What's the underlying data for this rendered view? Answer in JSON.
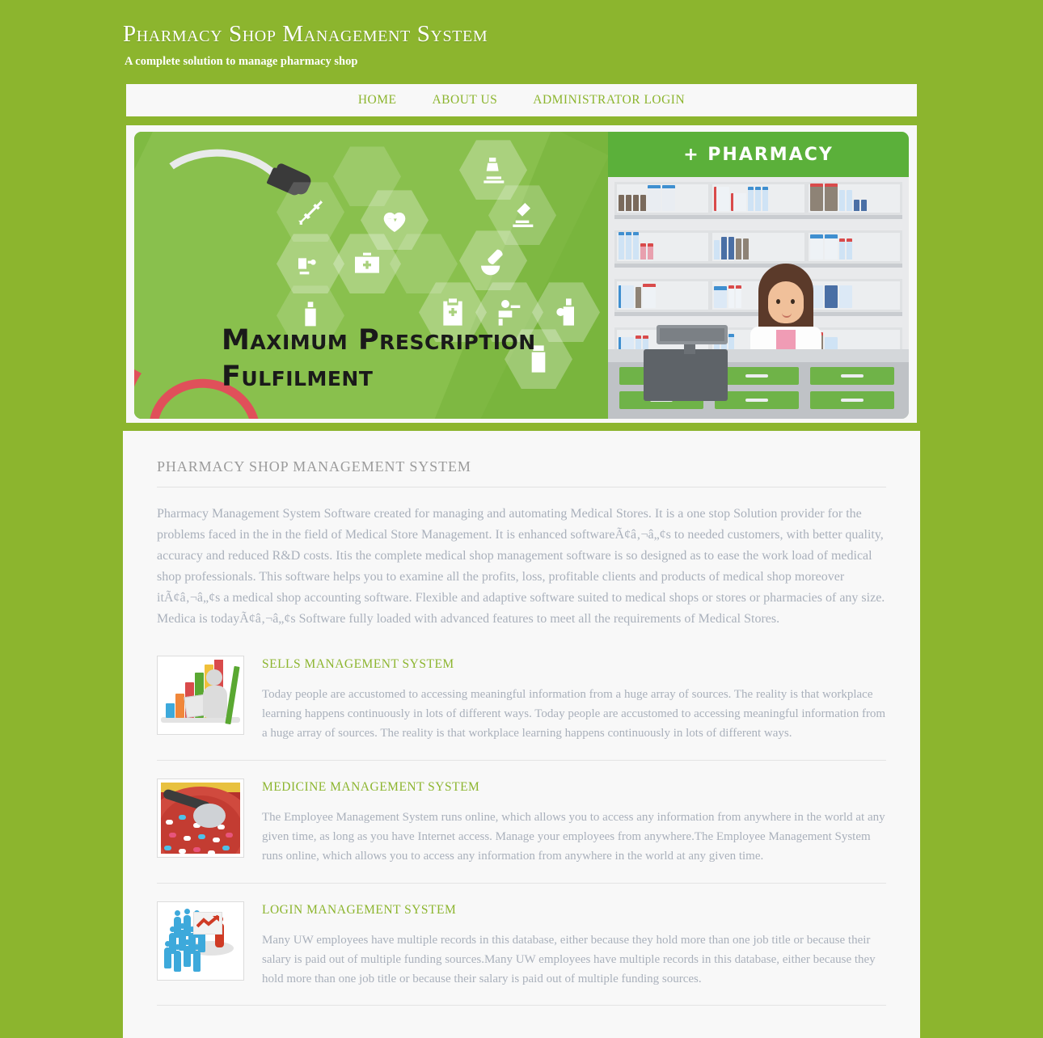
{
  "header": {
    "title": "Pharmacy Shop Management System",
    "tagline": "A complete solution to manage pharmacy shop"
  },
  "nav": {
    "items": [
      {
        "label": "HOME"
      },
      {
        "label": "ABOUT US"
      },
      {
        "label": "ADMINISTRATOR LOGIN"
      }
    ]
  },
  "banner": {
    "headline_line1": "Maximum Prescription",
    "headline_line2": "Fulfilment",
    "shop_sign": "+ PHARMACY",
    "icons": [
      "syringe-icon",
      "heartbeat-icon",
      "microscope-icon",
      "microscope-alt-icon",
      "blood-pressure-icon",
      "first-aid-kit-icon",
      "pills-mortar-icon",
      "nasal-spray-icon",
      "clipboard-medical-icon",
      "dental-chair-icon",
      "oxygen-tank-icon",
      "iv-bag-icon"
    ]
  },
  "main": {
    "section_title": "PHARMACY SHOP MANAGEMENT SYSTEM",
    "intro": "Pharmacy Management System Software created for managing and automating Medical Stores. It is a one stop Solution provider for the problems faced in the in the field of Medical Store Management. It is enhanced softwareÃ¢â‚¬â„¢s to needed customers, with better quality, accuracy and reduced R&D costs. Itis the complete medical shop management software is so designed as to ease the work load of medical shop professionals. This software helps you to examine all the profits, loss, profitable clients and products of medical shop moreover itÃ¢â‚¬â„¢s a medical shop accounting software. Flexible and adaptive software suited to medical shops or stores or pharmacies of any size. Medica is todayÃ¢â‚¬â„¢s Software fully loaded with advanced features to meet all the requirements of Medical Stores.",
    "features": [
      {
        "title": "SELLS MANAGEMENT SYSTEM",
        "text": "Today people are accustomed to accessing meaningful information from a huge array of sources. The reality is that workplace learning happens continuously in lots of different ways. Today people are accustomed to accessing meaningful information from a huge array of sources. The reality is that workplace learning happens continuously in lots of different ways.",
        "thumb": "bar-chart-figure-image"
      },
      {
        "title": "MEDICINE MANAGEMENT SYSTEM",
        "text": "The Employee Management System runs online, which allows you to access any information from anywhere in the world at any given time, as long as you have Internet access. Manage your employees from anywhere.The Employee Management System runs online, which allows you to access any information from anywhere in the world at any given time.",
        "thumb": "spoon-of-pills-image"
      },
      {
        "title": "LOGIN MANAGEMENT SYSTEM",
        "text": "Many UW employees have multiple records in this database, either because they hold more than one job title or because their salary is paid out of multiple funding sources.Many UW employees have multiple records in this database, either because they hold more than one job title or because their salary is paid out of multiple funding sources.",
        "thumb": "crowd-podium-image"
      }
    ]
  },
  "colors": {
    "brand_green": "#8cb52e",
    "panel": "#f8f8f8",
    "body_text": "#a9b0bb",
    "heading_gray": "#9b9b9b"
  }
}
